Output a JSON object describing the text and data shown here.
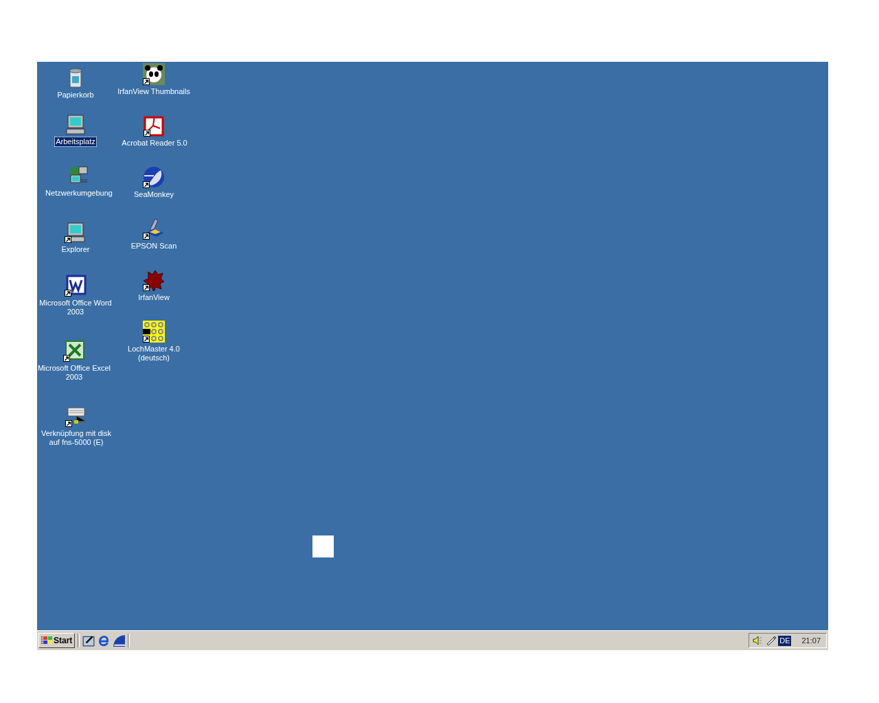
{
  "desktop": {
    "columns": [
      {
        "icons": [
          {
            "label": "Papierkorb",
            "kind": "recycle",
            "selected": false,
            "shortcut": false
          },
          {
            "label": "Arbeitsplatz",
            "kind": "computer",
            "selected": true,
            "shortcut": false
          },
          {
            "label": "Netzwerkumgebung",
            "kind": "network",
            "selected": false,
            "shortcut": false
          },
          {
            "label": "Explorer",
            "kind": "computer",
            "selected": false,
            "shortcut": true
          },
          {
            "label": "Microsoft Office Word 2003",
            "kind": "word",
            "selected": false,
            "shortcut": true
          },
          {
            "label": "Microsoft Office Excel 2003",
            "kind": "excel",
            "selected": false,
            "shortcut": true
          },
          {
            "label": "Verknüpfung mit disk auf fns-5000 (E)",
            "kind": "drive",
            "selected": false,
            "shortcut": true
          }
        ]
      },
      {
        "icons": [
          {
            "label": "IrfanView Thumbnails",
            "kind": "panda",
            "selected": false,
            "shortcut": true
          },
          {
            "label": "Acrobat Reader 5.0",
            "kind": "pdf",
            "selected": false,
            "shortcut": true
          },
          {
            "label": "SeaMonkey",
            "kind": "seamonkey",
            "selected": false,
            "shortcut": true
          },
          {
            "label": "EPSON Scan",
            "kind": "scanner",
            "selected": false,
            "shortcut": true
          },
          {
            "label": "IrfanView",
            "kind": "splat",
            "selected": false,
            "shortcut": true
          },
          {
            "label": "LochMaster 4.0 (deutsch)",
            "kind": "grid",
            "selected": false,
            "shortcut": true
          }
        ]
      }
    ]
  },
  "taskbar": {
    "start": "Start",
    "quick_launch": [
      {
        "kind": "desktop"
      },
      {
        "kind": "ie"
      },
      {
        "kind": "seamonkey"
      }
    ],
    "tray": [
      {
        "kind": "speaker"
      },
      {
        "kind": "usb"
      }
    ],
    "language": "DE",
    "clock": "21:07"
  }
}
